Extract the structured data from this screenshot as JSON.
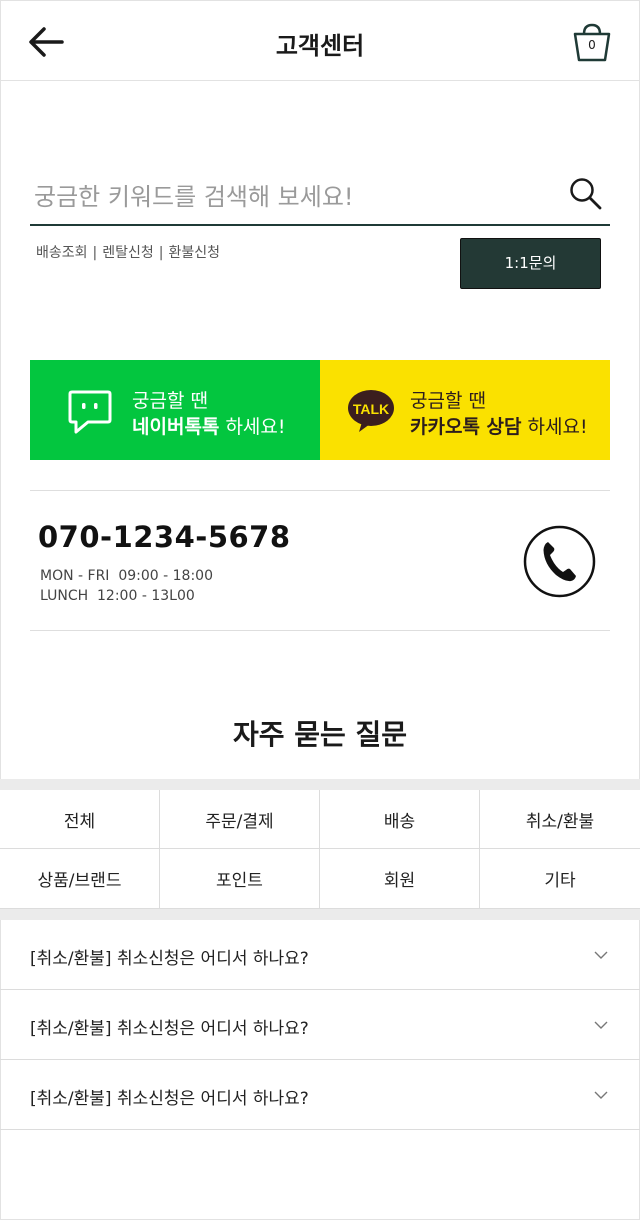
{
  "header": {
    "title": "고객센터",
    "cart_count": "0"
  },
  "search": {
    "placeholder": "궁금한 키워드를 검색해 보세요!",
    "value": ""
  },
  "quick_links": [
    "배송조회",
    "렌탈신청",
    "환불신청"
  ],
  "quick_link_separator": "|",
  "inquiry_button": "1:1문의",
  "banners": {
    "naver": {
      "line1": "궁금할 땐",
      "brand": "네이버톡톡",
      "suffix": " 하세요!",
      "color": "#03c63f",
      "icon": "naver-talk-icon"
    },
    "kakao": {
      "line1": "궁금할 땐",
      "brand": "카카오톡 상담",
      "suffix": " 하세요!",
      "color": "#fae100",
      "icon": "kakao-talk-icon",
      "badge": "TALK"
    }
  },
  "contact": {
    "phone": "070-1234-5678",
    "hours": "MON - FRI  09:00 - 18:00",
    "lunch": "LUNCH  12:00 - 13L00",
    "icon": "phone-icon"
  },
  "faq": {
    "title": "자주 묻는 질문",
    "categories": [
      "전체",
      "주문/결제",
      "배송",
      "취소/환불",
      "상품/브랜드",
      "포인트",
      "회원",
      "기타"
    ],
    "items": [
      {
        "question": "[취소/환불] 취소신청은 어디서 하나요?"
      },
      {
        "question": "[취소/환불] 취소신청은 어디서 하나요?"
      },
      {
        "question": "[취소/환불] 취소신청은 어디서 하나요?"
      }
    ]
  },
  "colors": {
    "accent_dark": "#233935",
    "naver_green": "#03c63f",
    "kakao_yellow": "#fae100"
  }
}
